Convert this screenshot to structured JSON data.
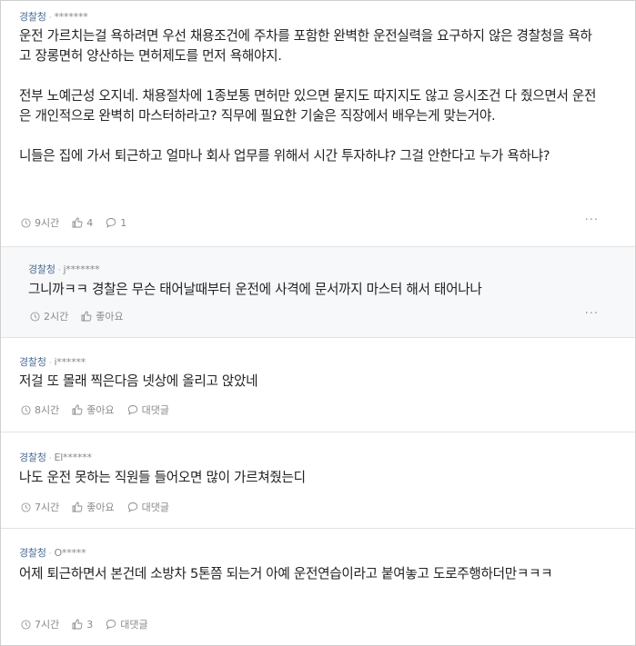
{
  "comments": [
    {
      "author": "경찰청",
      "user": "*******",
      "paragraphs": [
        "운전 가르치는걸 욕하려면 우선 채용조건에 주차를 포함한 완벽한 운전실력을 요구하지 않은 경찰청을 욕하고 장롱면허 양산하는 면허제도를 먼저 욕해야지.",
        "전부 노예근성 오지네. 채용절차에 1종보통 면허만 있으면 묻지도 따지지도 않고 응시조건 다 줬으면서 운전은 개인적으로 완벽히 마스터하라고? 직무에 필요한 기술은 직장에서 배우는게 맞는거야.",
        "니들은 집에 가서 퇴근하고 얼마나 회사 업무를 위해서 시간 투자하냐? 그걸 안한다고 누가 욕하냐?"
      ],
      "time": "9시간",
      "likes": "4",
      "replies": "1"
    },
    {
      "author": "경찰청",
      "user": "j*******",
      "paragraphs": [
        "그니까ㅋㅋ 경찰은 무슨 태어날때부터 운전에 사격에 문서까지 마스터 해서 태어나나"
      ],
      "time": "2시간",
      "likes": "좋아요"
    },
    {
      "author": "경찰청",
      "user": "i******",
      "paragraphs": [
        "저걸 또 몰래 찍은다음 넷상에 올리고 앉았네"
      ],
      "time": "8시간",
      "likes": "좋아요",
      "replies": "대댓글"
    },
    {
      "author": "경찰청",
      "user": "El******",
      "paragraphs": [
        "나도 운전 못하는 직원들 들어오면 많이 가르쳐줬는디"
      ],
      "time": "7시간",
      "likes": "좋아요",
      "replies": "대댓글"
    },
    {
      "author": "경찰청",
      "user": "O*****",
      "paragraphs": [
        "어제 퇴근하면서 본건데 소방차 5톤쯤 되는거 아예 운전연습이라고 붙여놓고 도로주행하더만ㅋㅋㅋ"
      ],
      "time": "7시간",
      "likes": "3",
      "replies": "대댓글"
    }
  ],
  "more_icon": "more-horizontal-icon",
  "colors": {
    "author": "#4f6f95",
    "reply_bg": "#f7f8fa",
    "text": "#222222",
    "muted": "#8a8a8a"
  }
}
